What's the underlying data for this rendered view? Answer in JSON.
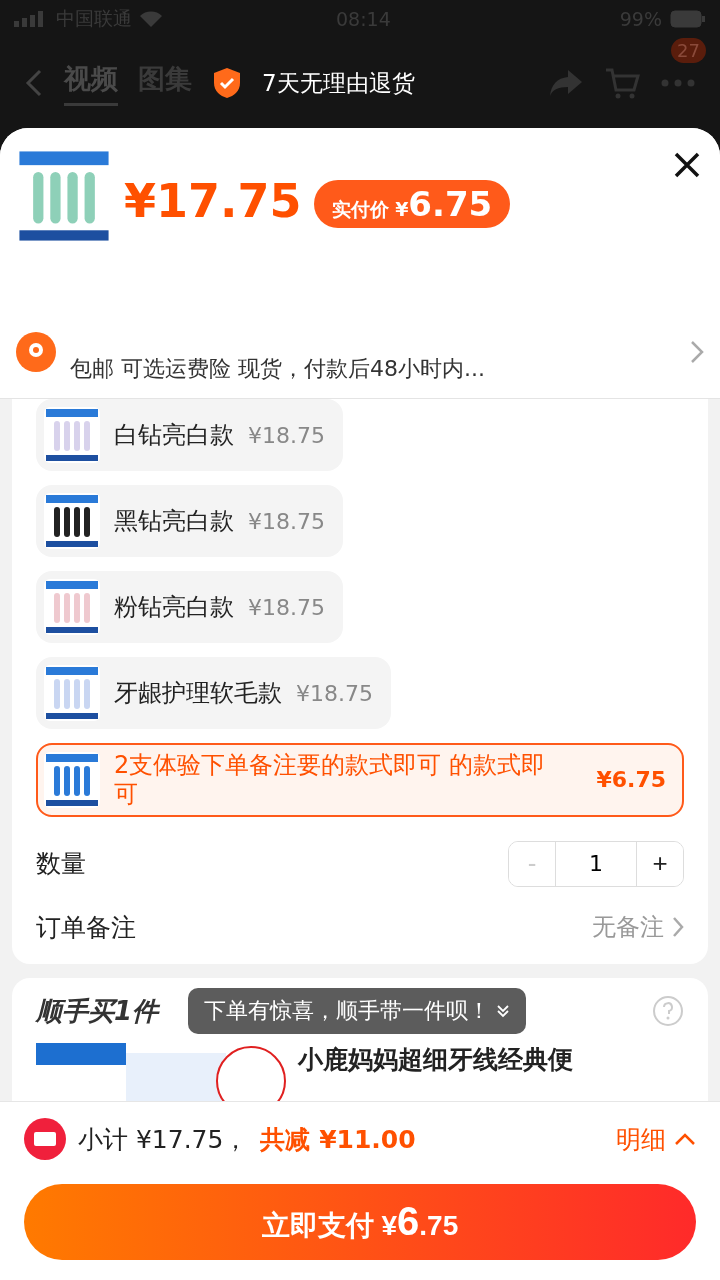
{
  "status_bar": {
    "carrier": "中国联通",
    "time": "08:14",
    "battery": "99%"
  },
  "nav": {
    "tabs": [
      {
        "label": "视频",
        "selected": true
      },
      {
        "label": "图集",
        "selected": false
      }
    ],
    "guarantee": "7天无理由退货",
    "cart_badge": "27"
  },
  "sheet": {
    "price": "¥17.75",
    "pay_label": "实付价 ¥",
    "pay_price": "6.75",
    "address_note": "包邮  可选运费险  现货，付款后48小时内...",
    "options": [
      {
        "name": "白钻亮白款",
        "price": "¥18.75",
        "selected": false
      },
      {
        "name": "黑钻亮白款",
        "price": "¥18.75",
        "selected": false
      },
      {
        "name": "粉钻亮白款",
        "price": "¥18.75",
        "selected": false
      },
      {
        "name": "牙龈护理软毛款",
        "price": "¥18.75",
        "selected": false
      },
      {
        "name": "2支体验下单备注要的款式即可 的款式即可",
        "price": "¥6.75",
        "selected": true
      }
    ],
    "quantity": {
      "label": "数量",
      "minus": "-",
      "value": "1",
      "plus": "+",
      "minus_disabled": true
    },
    "remark": {
      "label": "订单备注",
      "value": "无备注"
    }
  },
  "addon": {
    "title": "顺手买1件",
    "toast": "下单有惊喜，顺手带一件呗！",
    "product": "小鹿妈妈超细牙线经典便"
  },
  "footer": {
    "subtotal": "小计 ¥17.75，",
    "discount": "共减 ¥11.00",
    "detail": "明细",
    "pay_label": "立即支付 ¥",
    "pay_big": "6",
    "pay_small": ".75"
  }
}
